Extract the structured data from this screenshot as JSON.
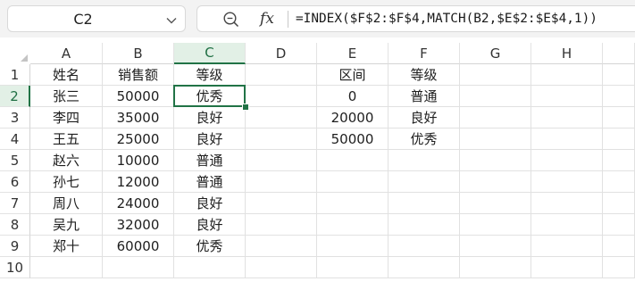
{
  "name_box": {
    "value": "C2"
  },
  "formula_bar": {
    "fx_label": "fx",
    "formula": "=INDEX($F$2:$F$4,MATCH(B2,$E$2:$E$4,1))"
  },
  "icons": {
    "zoom": "zoom-formula-icon",
    "dropdown": "chevron-down-icon"
  },
  "colors": {
    "accent": "#217346",
    "header_selected_bg": "#e2f0e6"
  },
  "sheet": {
    "selected_cell": "C2",
    "columns": [
      "A",
      "B",
      "C",
      "D",
      "E",
      "F",
      "G",
      "H"
    ],
    "rows": [
      "1",
      "2",
      "3",
      "4",
      "5",
      "6",
      "7",
      "8",
      "9",
      "10"
    ],
    "cells": [
      [
        "姓名",
        "销售额",
        "等级",
        "",
        "区间",
        "等级",
        "",
        ""
      ],
      [
        "张三",
        "50000",
        "优秀",
        "",
        "0",
        "普通",
        "",
        ""
      ],
      [
        "李四",
        "35000",
        "良好",
        "",
        "20000",
        "良好",
        "",
        ""
      ],
      [
        "王五",
        "25000",
        "良好",
        "",
        "50000",
        "优秀",
        "",
        ""
      ],
      [
        "赵六",
        "10000",
        "普通",
        "",
        "",
        "",
        "",
        ""
      ],
      [
        "孙七",
        "12000",
        "普通",
        "",
        "",
        "",
        "",
        ""
      ],
      [
        "周八",
        "24000",
        "良好",
        "",
        "",
        "",
        "",
        ""
      ],
      [
        "吴九",
        "32000",
        "良好",
        "",
        "",
        "",
        "",
        ""
      ],
      [
        "郑十",
        "60000",
        "优秀",
        "",
        "",
        "",
        "",
        ""
      ],
      [
        "",
        "",
        "",
        "",
        "",
        "",
        "",
        ""
      ]
    ]
  }
}
